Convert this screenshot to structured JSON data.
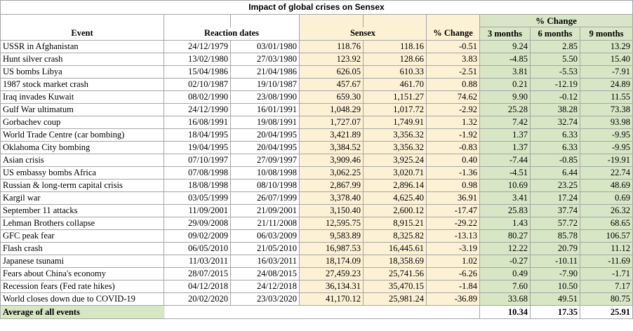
{
  "table": {
    "title": "Impact of global crises on Sensex",
    "headers": {
      "event": "Event",
      "reaction_dates": "Reaction dates",
      "sensex": "Sensex",
      "pct_change": "% Change",
      "pct_change_group": "% Change",
      "m3": "3 months",
      "m6": "6 months",
      "m9": "9 months"
    },
    "colors": {
      "sensex_fill": "#fdf1d5",
      "change_fill": "#d7e6c5",
      "grid": "#a6a6a6"
    },
    "rows": [
      [
        "USSR in Afghanistan",
        "24/12/1979",
        "03/01/1980",
        "118.76",
        "118.16",
        "-0.51",
        "9.24",
        "2.85",
        "13.29"
      ],
      [
        "Hunt silver crash",
        "13/02/1980",
        "27/03/1980",
        "123.92",
        "128.66",
        "3.83",
        "-4.85",
        "5.50",
        "15.40"
      ],
      [
        "US bombs Libya",
        "15/04/1986",
        "21/04/1986",
        "626.05",
        "610.33",
        "-2.51",
        "3.81",
        "-5.53",
        "-7.91"
      ],
      [
        "1987 stock market crash",
        "02/10/1987",
        "19/10/1987",
        "457.67",
        "461.70",
        "0.88",
        "0.21",
        "-12.19",
        "24.89"
      ],
      [
        "Iraq invades Kuwait",
        "08/02/1990",
        "23/08/1990",
        "659.30",
        "1,151.27",
        "74.62",
        "9.90",
        "-0.12",
        "11.55"
      ],
      [
        "Gulf War ultimatum",
        "24/12/1990",
        "16/01/1991",
        "1,048.29",
        "1,017.72",
        "-2.92",
        "25.28",
        "38.28",
        "73.38"
      ],
      [
        "Gorbachev coup",
        "16/08/1991",
        "19/08/1991",
        "1,727.07",
        "1,749.91",
        "1.32",
        "7.42",
        "32.74",
        "93.98"
      ],
      [
        "World Trade Centre (car bombing)",
        "18/04/1995",
        "20/04/1995",
        "3,421.89",
        "3,356.32",
        "-1.92",
        "1.37",
        "6.33",
        "-9.95"
      ],
      [
        "Oklahoma City bombing",
        "19/04/1995",
        "20/04/1995",
        "3,384.52",
        "3,356.32",
        "-0.83",
        "1.37",
        "6.33",
        "-9.95"
      ],
      [
        "Asian crisis",
        "07/10/1997",
        "27/09/1997",
        "3,909.46",
        "3,925.24",
        "0.40",
        "-7.44",
        "-0.85",
        "-19.91"
      ],
      [
        "US embassy bombs Africa",
        "07/08/1998",
        "10/08/1998",
        "3,062.25",
        "3,020.71",
        "-1.36",
        "-4.51",
        "6.44",
        "22.74"
      ],
      [
        "Russian & long-term capital crisis",
        "18/08/1998",
        "08/10/1998",
        "2,867.99",
        "2,896.14",
        "0.98",
        "10.69",
        "23.25",
        "48.69"
      ],
      [
        "Kargil war",
        "03/05/1999",
        "26/07/1999",
        "3,378.40",
        "4,625.40",
        "36.91",
        "3.41",
        "17.24",
        "0.69"
      ],
      [
        "September 11 attacks",
        "11/09/2001",
        "21/09/2001",
        "3,150.40",
        "2,600.12",
        "-17.47",
        "25.83",
        "37.74",
        "26.32"
      ],
      [
        "Lehman Brothers collapse",
        "29/09/2008",
        "21/11/2008",
        "12,595.75",
        "8,915.21",
        "-29.22",
        "1.43",
        "57.72",
        "68.65"
      ],
      [
        "GFC peak fear",
        "09/02/2009",
        "06/03/2009",
        "9,583.89",
        "8,325.82",
        "-13.13",
        "80.27",
        "85.78",
        "106.57"
      ],
      [
        "Flash crash",
        "06/05/2010",
        "21/05/2010",
        "16,987.53",
        "16,445.61",
        "-3.19",
        "12.22",
        "20.79",
        "11.12"
      ],
      [
        "Japanese tsunami",
        "11/03/2011",
        "16/03/2011",
        "18,174.09",
        "18,358.69",
        "1.02",
        "-0.27",
        "-10.11",
        "-11.69"
      ],
      [
        "Fears about China's economy",
        "28/07/2015",
        "24/08/2015",
        "27,459.23",
        "25,741.56",
        "-6.26",
        "0.49",
        "-7.90",
        "-1.71"
      ],
      [
        "Recession fears (Fed rate hikes)",
        "04/12/2018",
        "24/12/2018",
        "36,134.31",
        "35,470.15",
        "-1.84",
        "7.60",
        "10.50",
        "7.17"
      ],
      [
        "World closes down due to COVID-19",
        "20/02/2020",
        "23/03/2020",
        "41,170.12",
        "25,981.24",
        "-36.89",
        "33.68",
        "49.51",
        "80.75"
      ]
    ],
    "average": {
      "label": "Average of all events",
      "m3": "10.34",
      "m6": "17.35",
      "m9": "25.91"
    }
  }
}
